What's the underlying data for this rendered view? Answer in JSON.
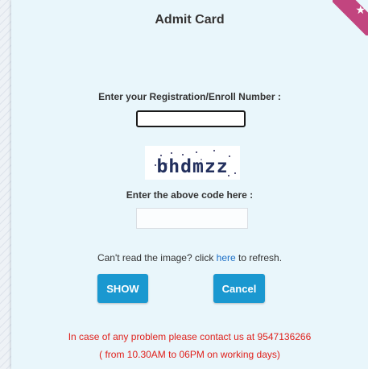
{
  "title": "Admit Card",
  "registration": {
    "label": "Enter your Registration/Enroll Number :",
    "value": ""
  },
  "captcha": {
    "text": "bhdmzz",
    "label": "Enter the above code here :",
    "value": ""
  },
  "refresh": {
    "prefix": "Can't read the image? click ",
    "link": "here",
    "suffix": " to refresh."
  },
  "buttons": {
    "show": "SHOW",
    "cancel": "Cancel"
  },
  "contact": {
    "line1": "In case of any problem please contact us at 9547136266",
    "line2": "( from 10.30AM to 06PM on working days)"
  },
  "colors": {
    "button": "#1a98d0",
    "contact_text": "#e0201b",
    "link": "#1d6fc6",
    "ribbon": "#c2457f"
  },
  "icons": {
    "ribbon": "star-icon"
  }
}
